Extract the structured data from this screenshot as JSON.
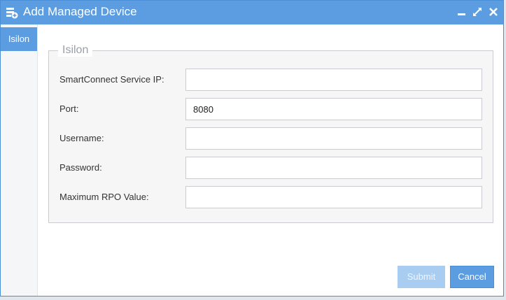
{
  "window": {
    "title": "Add Managed Device"
  },
  "sidebar": {
    "tabs": [
      {
        "label": "Isilon",
        "active": true
      }
    ]
  },
  "form": {
    "legend": "Isilon",
    "fields": [
      {
        "label": "SmartConnect Service IP:",
        "value": ""
      },
      {
        "label": "Port:",
        "value": "8080"
      },
      {
        "label": "Username:",
        "value": ""
      },
      {
        "label": "Password:",
        "value": ""
      },
      {
        "label": "Maximum RPO Value:",
        "value": ""
      }
    ]
  },
  "buttons": {
    "submit": "Submit",
    "cancel": "Cancel"
  },
  "colors": {
    "accent": "#5b9de0",
    "disabled": "#a9cdf0"
  },
  "icons": {
    "title": "add-device-icon",
    "minimize": "minimize-icon",
    "maximize": "maximize-icon",
    "close": "close-icon"
  }
}
